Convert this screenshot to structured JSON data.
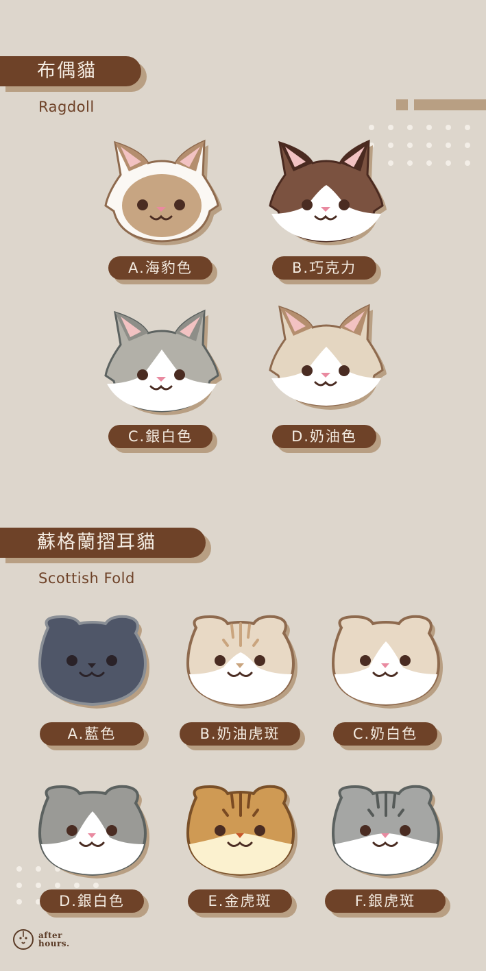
{
  "ragdoll": {
    "title": "布偶貓",
    "subtitle": "Ragdoll",
    "cats": [
      {
        "label": "A.海豹色",
        "icon": "seal-point-ragdoll-icon"
      },
      {
        "label": "B.巧克力",
        "icon": "chocolate-ragdoll-icon"
      },
      {
        "label": "C.銀白色",
        "icon": "silver-white-ragdoll-icon"
      },
      {
        "label": "D.奶油色",
        "icon": "cream-ragdoll-icon"
      }
    ]
  },
  "scottish_fold": {
    "title": "蘇格蘭摺耳貓",
    "subtitle": "Scottish Fold",
    "cats": [
      {
        "label": "A.藍色",
        "icon": "blue-fold-icon"
      },
      {
        "label": "B.奶油虎斑",
        "icon": "cream-tabby-fold-icon"
      },
      {
        "label": "C.奶白色",
        "icon": "cream-white-fold-icon"
      },
      {
        "label": "D.銀白色",
        "icon": "silver-white-fold-icon"
      },
      {
        "label": "E.金虎斑",
        "icon": "golden-tabby-fold-icon"
      },
      {
        "label": "F.銀虎斑",
        "icon": "silver-tabby-fold-icon"
      }
    ]
  },
  "logo": {
    "line1": "after",
    "line2": "hours."
  },
  "colors": {
    "background": "#ddd6cc",
    "brown": "#6e4228",
    "shadow": "#b89f83",
    "cream_text": "#f4ece2"
  }
}
